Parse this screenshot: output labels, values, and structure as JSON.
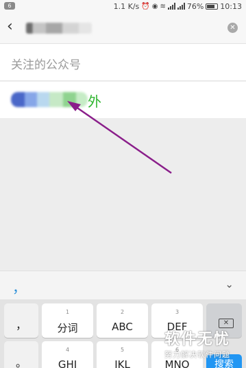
{
  "status_bar": {
    "notification_count": "6",
    "net_speed": "1.1 K/s",
    "battery": "76%",
    "time": "10:13"
  },
  "search": {
    "back_icon": "back-arrow-icon",
    "clear_icon": "clear-icon"
  },
  "section": {
    "title": "关注的公众号"
  },
  "result": {
    "suffix": "外"
  },
  "keyboard": {
    "candidate": "，",
    "collapse_icon": "chevron-down-icon",
    "keys": [
      {
        "num": "",
        "label": "，"
      },
      {
        "num": "1",
        "label": "分词"
      },
      {
        "num": "2",
        "label": "ABC"
      },
      {
        "num": "3",
        "label": "DEF"
      },
      {
        "num": "",
        "label": "。"
      },
      {
        "num": "4",
        "label": "GHI"
      },
      {
        "num": "5",
        "label": "JKL"
      },
      {
        "num": "6",
        "label": "MNO"
      }
    ],
    "search_label": "搜索",
    "accent_color": "#2196f3"
  },
  "annotation": {
    "arrow_color": "#8a1e8a"
  },
  "watermark": {
    "title": "软件无忧",
    "subtitle": "努力解决软件问题"
  }
}
